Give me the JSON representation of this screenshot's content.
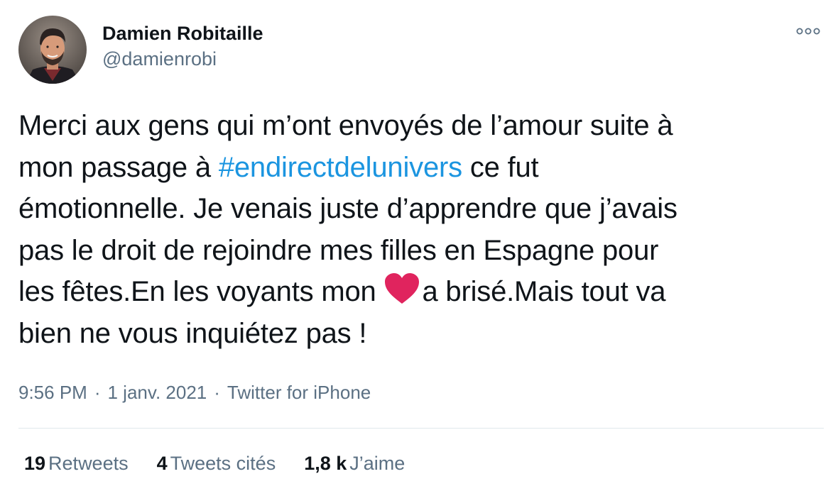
{
  "author": {
    "display_name": "Damien Robitaille",
    "handle": "@damienrobi",
    "avatar_icon": "profile-photo"
  },
  "more_icon": "more-options-icon",
  "tweet": {
    "lines": [
      {
        "pre": "Merci aux gens qui m’ont envoyés de l’amour suite à"
      },
      {
        "pre": "mon passage à ",
        "hashtag": "#endirectdelunivers",
        "post": " ce fut"
      },
      {
        "pre": "émotionnelle. Je venais juste d’apprendre que j’avais"
      },
      {
        "pre": "pas le droit de rejoindre mes filles en Espagne pour"
      },
      {
        "pre": "les fêtes.En les voyants mon ",
        "emoji": "red-heart-icon",
        "post": "a brisé.Mais tout va"
      },
      {
        "pre": "bien ne vous inquiétez pas !"
      }
    ],
    "hashtag_color": "#1b95e0",
    "heart_color": "#e0245e"
  },
  "meta": {
    "time": "9:56 PM",
    "separator": "·",
    "date": "1 janv. 2021",
    "source": "Twitter for iPhone"
  },
  "stats": {
    "retweets_count": "19",
    "retweets_label": "Retweets",
    "quotes_count": "4",
    "quotes_label": "Tweets cités",
    "likes_count": "1,8 k",
    "likes_label": "J’aime"
  }
}
